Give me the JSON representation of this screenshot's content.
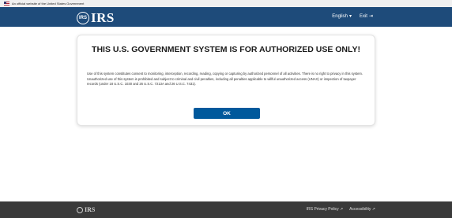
{
  "gov_banner": {
    "text": "An official website of the United States Government"
  },
  "header": {
    "logo_text": "IRS",
    "logo_mark": "IRS",
    "nav": [
      {
        "label": "English",
        "icon": "chevron-down-icon"
      },
      {
        "label": "Exit",
        "icon": "exit-icon"
      }
    ]
  },
  "notice": {
    "title": "THIS U.S. GOVERNMENT SYSTEM IS FOR AUTHORIZED USE ONLY!",
    "body": "Use of this system constitutes consent to monitoring, interception, recording, reading, copying or capturing by authorized personnel of all activities. There is no right to privacy in this system. Unauthorized use of this system is prohibited and subject to criminal and civil penalties, including all penalties applicable to willful unauthorized access (UNAX) or inspection of taxpayer records (under 18 U.S.C. 1030 and 26 U.S.C. 7213A and 26 U.S.C. 7431).",
    "ok_label": "OK"
  },
  "footer": {
    "logo_text": "IRS",
    "links": [
      {
        "label": "IRS Privacy Policy"
      },
      {
        "label": "Accessibility"
      }
    ]
  },
  "colors": {
    "header_bg": "#1e4b7a",
    "button_bg": "#00599c",
    "footer_bg": "#3a3a3a"
  }
}
